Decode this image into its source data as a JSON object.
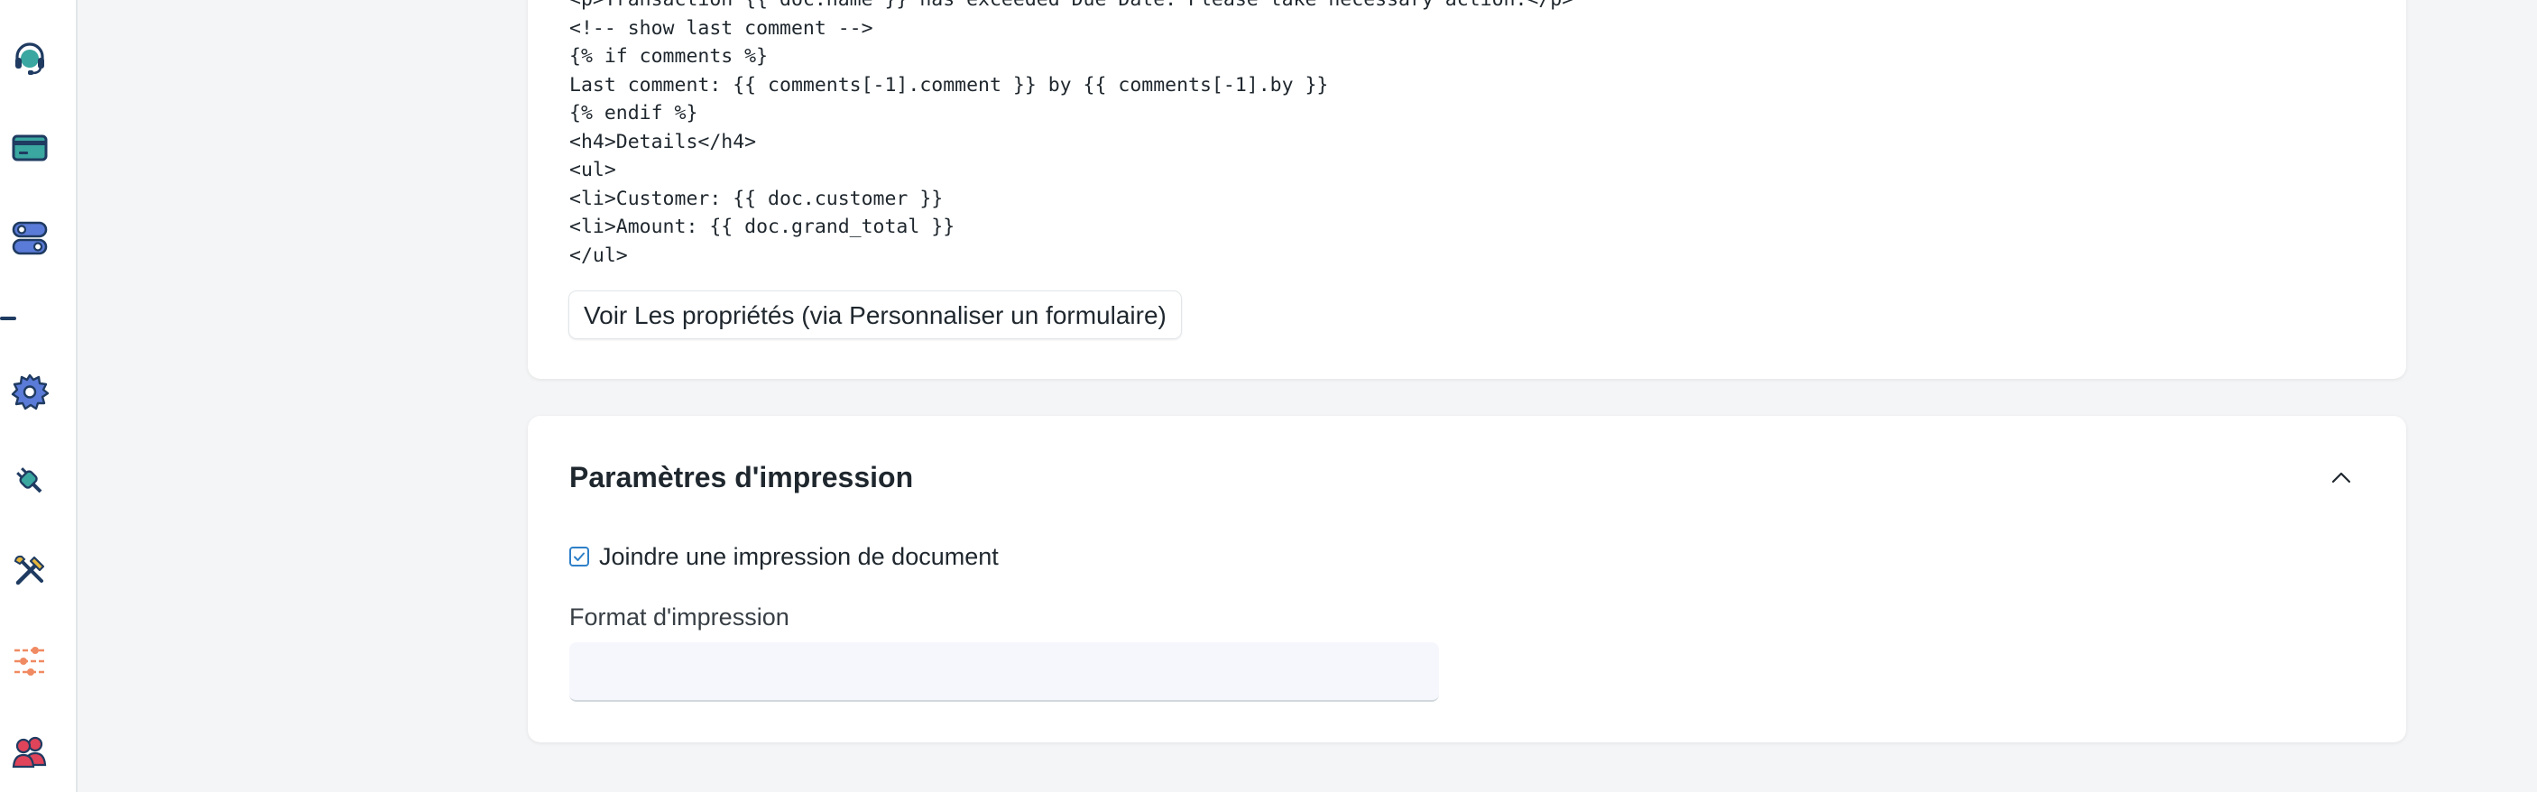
{
  "sidebar": {
    "items": [
      {
        "icon": "headset-icon"
      },
      {
        "icon": "credit-card-icon"
      },
      {
        "icon": "toggles-icon"
      },
      {
        "icon": "gear-icon"
      },
      {
        "icon": "plug-icon"
      },
      {
        "icon": "tools-icon"
      },
      {
        "icon": "sliders-icon"
      },
      {
        "icon": "users-icon"
      }
    ]
  },
  "code_card": {
    "lines": [
      "<p>Transaction {{ doc.name }} has exceeded Due Date. Please take necessary action.</p>",
      "<!-- show last comment -->",
      "{% if comments %}",
      "Last comment: {{ comments[-1].comment }} by {{ comments[-1].by }}",
      "{% endif %}",
      "<h4>Details</h4>",
      "<ul>",
      "<li>Customer: {{ doc.customer }}",
      "<li>Amount: {{ doc.grand_total }}",
      "</ul>"
    ],
    "properties_button_label": "Voir Les propriétés (via Personnaliser un formulaire)"
  },
  "print_settings": {
    "title": "Paramètres d'impression",
    "attach_print_label": "Joindre une impression de document",
    "attach_print_checked": true,
    "print_format_label": "Format d'impression",
    "print_format_value": ""
  },
  "colors": {
    "accent": "#2f80c9",
    "text": "#1f272e",
    "background": "#f4f5f6"
  }
}
